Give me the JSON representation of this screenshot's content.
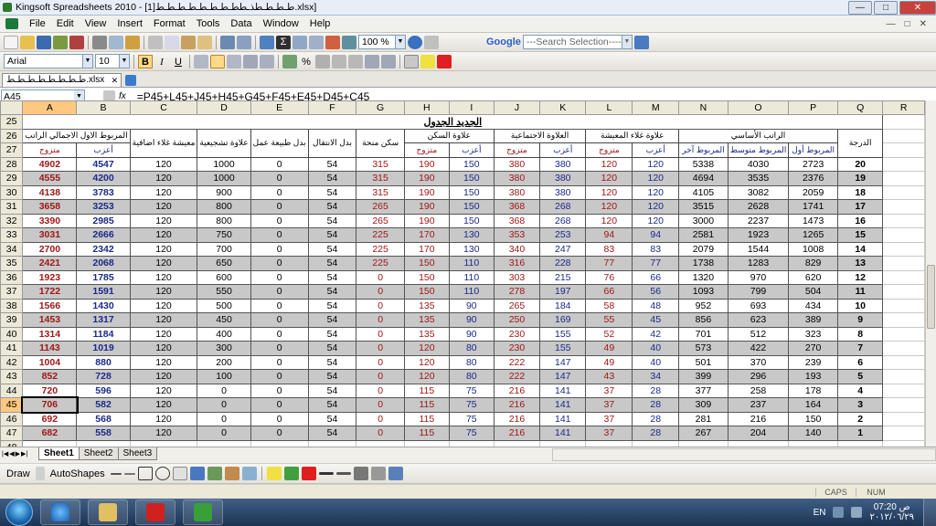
{
  "window": {
    "title": "Kingsoft Spreadsheets 2010 - [1]طـطـطـطذـططـطـطـطـطـطـطـط.xlsx]",
    "min": "—",
    "max": "□",
    "close": "✕"
  },
  "menu": [
    "File",
    "Edit",
    "View",
    "Insert",
    "Format",
    "Tools",
    "Data",
    "Window",
    "Help"
  ],
  "toolbar": {
    "zoom": "100 %",
    "search_placeholder": "---Search Selection----",
    "google": "Google"
  },
  "format": {
    "font": "Arial",
    "size": "10",
    "bold": "B",
    "italic": "I",
    "underline": "U",
    "percent": "%"
  },
  "doc_tab": "طـطـطـطـطـطـطـط.xlsx",
  "formula_bar": {
    "cell": "A45",
    "fx": "fx",
    "formula": "=P45+L45+J45+H45+G45+F45+E45+D45+C45"
  },
  "columns": [
    "A",
    "B",
    "C",
    "D",
    "E",
    "F",
    "G",
    "H",
    "I",
    "J",
    "K",
    "L",
    "M",
    "N",
    "O",
    "P",
    "Q",
    "R"
  ],
  "sheet": {
    "title": "الجديد الجدول",
    "row_nums": [
      "25",
      "26",
      "27",
      "28",
      "29",
      "30",
      "31",
      "32",
      "33",
      "34",
      "35",
      "36",
      "37",
      "38",
      "39",
      "40",
      "41",
      "42",
      "43",
      "44",
      "45",
      "46",
      "47",
      "48",
      "49"
    ],
    "hdr26": {
      "A": "المربوط الاول الاجمالي الراتب",
      "C": "معيشة غلاء اضافية",
      "D": "علاوة تشجيعية",
      "E": "بدل طبيعة عمل",
      "F": "بدل الانتقال",
      "G": "سكن منحة",
      "H": "علاوة السكن",
      "J": "العلاوة الاجتماعية",
      "L": "علاوة غلاء المعيشة",
      "N": "الراتب الأساسي",
      "Q": "الدرجة"
    },
    "hdr27": {
      "A": "متزوج",
      "B": "أعزب",
      "H": "متزوج",
      "I": "أعزب",
      "J": "متزوج",
      "K": "أعزب",
      "L": "متزوج",
      "M": "أعزب",
      "N": "المربوط آخر",
      "O": "المربوط متوسط",
      "P": "المربوط أول"
    },
    "rows": [
      [
        "4902",
        "4547",
        "120",
        "1000",
        "0",
        "54",
        "315",
        "190",
        "150",
        "380",
        "380",
        "120",
        "120",
        "5338",
        "4030",
        "2723",
        "20"
      ],
      [
        "4555",
        "4200",
        "120",
        "1000",
        "0",
        "54",
        "315",
        "190",
        "150",
        "380",
        "380",
        "120",
        "120",
        "4694",
        "3535",
        "2376",
        "19"
      ],
      [
        "4138",
        "3783",
        "120",
        "900",
        "0",
        "54",
        "315",
        "190",
        "150",
        "380",
        "380",
        "120",
        "120",
        "4105",
        "3082",
        "2059",
        "18"
      ],
      [
        "3658",
        "3253",
        "120",
        "800",
        "0",
        "54",
        "265",
        "190",
        "150",
        "368",
        "268",
        "120",
        "120",
        "3515",
        "2628",
        "1741",
        "17"
      ],
      [
        "3390",
        "2985",
        "120",
        "800",
        "0",
        "54",
        "265",
        "190",
        "150",
        "368",
        "268",
        "120",
        "120",
        "3000",
        "2237",
        "1473",
        "16"
      ],
      [
        "3031",
        "2666",
        "120",
        "750",
        "0",
        "54",
        "225",
        "170",
        "130",
        "353",
        "253",
        "94",
        "94",
        "2581",
        "1923",
        "1265",
        "15"
      ],
      [
        "2700",
        "2342",
        "120",
        "700",
        "0",
        "54",
        "225",
        "170",
        "130",
        "340",
        "247",
        "83",
        "83",
        "2079",
        "1544",
        "1008",
        "14"
      ],
      [
        "2421",
        "2068",
        "120",
        "650",
        "0",
        "54",
        "225",
        "150",
        "110",
        "316",
        "228",
        "77",
        "77",
        "1738",
        "1283",
        "829",
        "13"
      ],
      [
        "1923",
        "1785",
        "120",
        "600",
        "0",
        "54",
        "0",
        "150",
        "110",
        "303",
        "215",
        "76",
        "66",
        "1320",
        "970",
        "620",
        "12"
      ],
      [
        "1722",
        "1591",
        "120",
        "550",
        "0",
        "54",
        "0",
        "150",
        "110",
        "278",
        "197",
        "66",
        "56",
        "1093",
        "799",
        "504",
        "11"
      ],
      [
        "1566",
        "1430",
        "120",
        "500",
        "0",
        "54",
        "0",
        "135",
        "90",
        "265",
        "184",
        "58",
        "48",
        "952",
        "693",
        "434",
        "10"
      ],
      [
        "1453",
        "1317",
        "120",
        "450",
        "0",
        "54",
        "0",
        "135",
        "90",
        "250",
        "169",
        "55",
        "45",
        "856",
        "623",
        "389",
        "9"
      ],
      [
        "1314",
        "1184",
        "120",
        "400",
        "0",
        "54",
        "0",
        "135",
        "90",
        "230",
        "155",
        "52",
        "42",
        "701",
        "512",
        "323",
        "8"
      ],
      [
        "1143",
        "1019",
        "120",
        "300",
        "0",
        "54",
        "0",
        "120",
        "80",
        "230",
        "155",
        "49",
        "40",
        "573",
        "422",
        "270",
        "7"
      ],
      [
        "1004",
        "880",
        "120",
        "200",
        "0",
        "54",
        "0",
        "120",
        "80",
        "222",
        "147",
        "49",
        "40",
        "501",
        "370",
        "239",
        "6"
      ],
      [
        "852",
        "728",
        "120",
        "100",
        "0",
        "54",
        "0",
        "120",
        "80",
        "222",
        "147",
        "43",
        "34",
        "399",
        "296",
        "193",
        "5"
      ],
      [
        "720",
        "596",
        "120",
        "0",
        "0",
        "54",
        "0",
        "115",
        "75",
        "216",
        "141",
        "37",
        "28",
        "377",
        "258",
        "178",
        "4"
      ],
      [
        "706",
        "582",
        "120",
        "0",
        "0",
        "54",
        "0",
        "115",
        "75",
        "216",
        "141",
        "37",
        "28",
        "309",
        "237",
        "164",
        "3"
      ],
      [
        "692",
        "568",
        "120",
        "0",
        "0",
        "54",
        "0",
        "115",
        "75",
        "216",
        "141",
        "37",
        "28",
        "281",
        "216",
        "150",
        "2"
      ],
      [
        "682",
        "558",
        "120",
        "0",
        "0",
        "54",
        "0",
        "115",
        "75",
        "216",
        "141",
        "37",
        "28",
        "267",
        "204",
        "140",
        "1"
      ]
    ]
  },
  "sheet_tabs": [
    "Sheet1",
    "Sheet2",
    "Sheet3"
  ],
  "drawbar": {
    "draw": "Draw",
    "autoshapes": "AutoShapes"
  },
  "status": {
    "caps": "CAPS",
    "num": "NUM"
  },
  "taskbar": {
    "lang": "EN",
    "time": "ص 07:20",
    "date": "٢٠١٢/٠٦/٢٩"
  }
}
